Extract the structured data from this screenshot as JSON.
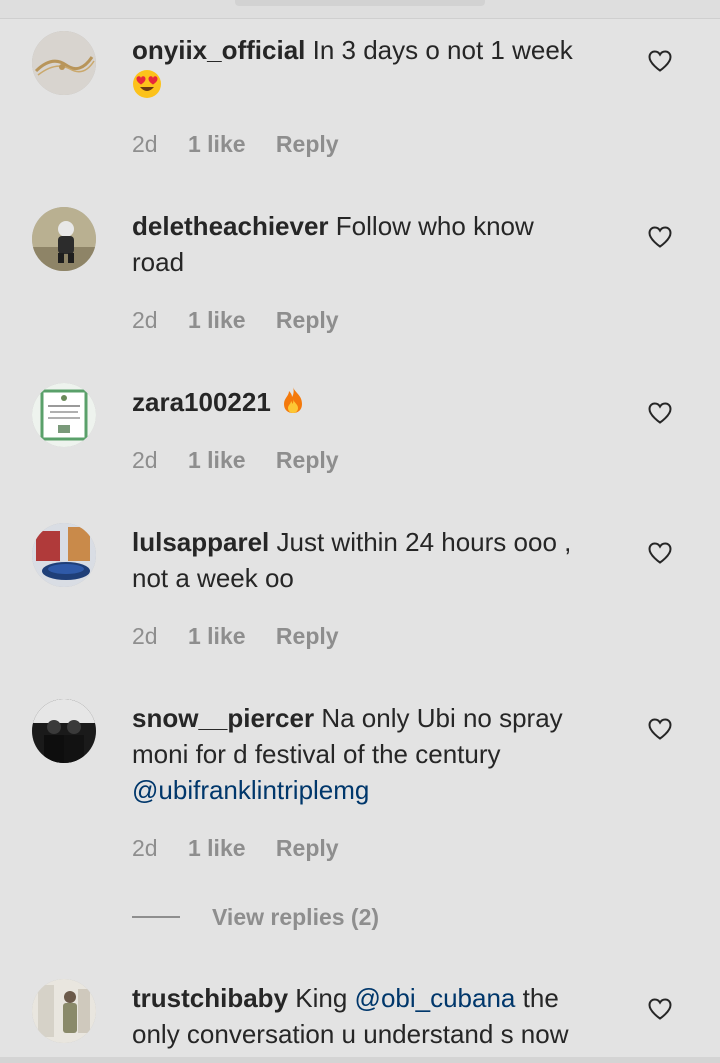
{
  "comments": [
    {
      "username": "onyiix_official",
      "text": "In 3 days o not 1 week",
      "emoji": "heart-eyes-emoji",
      "time": "2d",
      "likes": "1 like",
      "reply": "Reply"
    },
    {
      "username": "deletheachiever",
      "text": "Follow who know road",
      "time": "2d",
      "likes": "1 like",
      "reply": "Reply"
    },
    {
      "username": "zara100221",
      "text": "",
      "emoji": "fire-emoji",
      "time": "2d",
      "likes": "1 like",
      "reply": "Reply"
    },
    {
      "username": "lulsapparel",
      "text": "Just within 24 hours ooo , not a week oo",
      "time": "2d",
      "likes": "1 like",
      "reply": "Reply"
    },
    {
      "username": "snow__piercer",
      "text": "Na only Ubi no spray moni for d festival of the century",
      "mention": "@ubifranklintriplemg",
      "time": "2d",
      "likes": "1 like",
      "reply": "Reply",
      "view_replies": "View replies (2)"
    },
    {
      "username": "trustchibaby",
      "text_before": "King",
      "mention": "@obi_cubana",
      "text_after": "the only conversation u understand s now"
    }
  ],
  "colors": {
    "background": "#e3e3e3",
    "text": "#262626",
    "meta": "#8e8e8e",
    "mention": "#00376b"
  }
}
